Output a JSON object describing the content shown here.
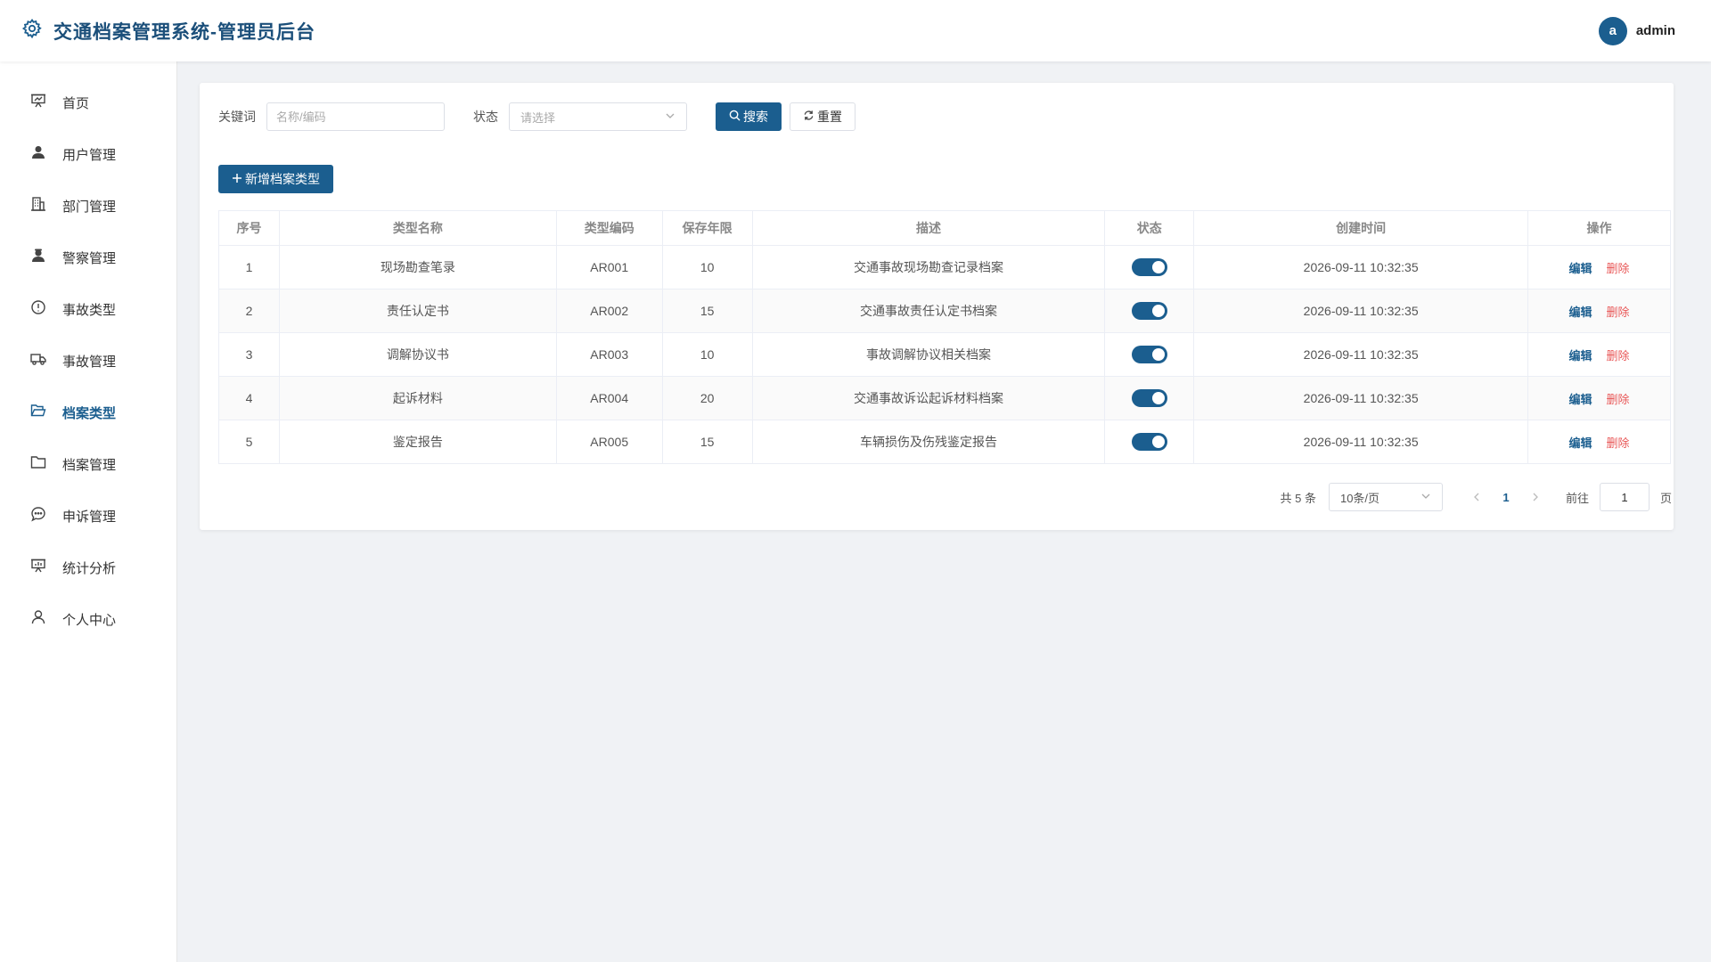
{
  "app": {
    "title": "交通档案管理系统-管理员后台"
  },
  "user": {
    "avatar_letter": "a",
    "name": "admin"
  },
  "sidebar": {
    "items": [
      {
        "label": "首页",
        "icon": "presentation-icon",
        "active": false
      },
      {
        "label": "用户管理",
        "icon": "user-icon",
        "active": false
      },
      {
        "label": "部门管理",
        "icon": "building-icon",
        "active": false
      },
      {
        "label": "警察管理",
        "icon": "police-icon",
        "active": false
      },
      {
        "label": "事故类型",
        "icon": "warning-circle-icon",
        "active": false
      },
      {
        "label": "事故管理",
        "icon": "truck-icon",
        "active": false
      },
      {
        "label": "档案类型",
        "icon": "folder-open-icon",
        "active": true
      },
      {
        "label": "档案管理",
        "icon": "folder-icon",
        "active": false
      },
      {
        "label": "申诉管理",
        "icon": "chat-icon",
        "active": false
      },
      {
        "label": "统计分析",
        "icon": "chart-board-icon",
        "active": false
      },
      {
        "label": "个人中心",
        "icon": "person-outline-icon",
        "active": false
      }
    ]
  },
  "filter": {
    "keyword_label": "关键词",
    "keyword_placeholder": "名称/编码",
    "keyword_value": "",
    "status_label": "状态",
    "status_placeholder": "请选择",
    "search_label": "搜索",
    "reset_label": "重置"
  },
  "toolbar": {
    "add_label": "新增档案类型"
  },
  "table": {
    "columns": [
      "序号",
      "类型名称",
      "类型编码",
      "保存年限",
      "描述",
      "状态",
      "创建时间",
      "操作"
    ],
    "rows": [
      {
        "index": "1",
        "name": "现场勘查笔录",
        "code": "AR001",
        "years": "10",
        "desc": "交通事故现场勘查记录档案",
        "enabled": true,
        "created": "2026-09-11 10:32:35"
      },
      {
        "index": "2",
        "name": "责任认定书",
        "code": "AR002",
        "years": "15",
        "desc": "交通事故责任认定书档案",
        "enabled": true,
        "created": "2026-09-11 10:32:35"
      },
      {
        "index": "3",
        "name": "调解协议书",
        "code": "AR003",
        "years": "10",
        "desc": "事故调解协议相关档案",
        "enabled": true,
        "created": "2026-09-11 10:32:35"
      },
      {
        "index": "4",
        "name": "起诉材料",
        "code": "AR004",
        "years": "20",
        "desc": "交通事故诉讼起诉材料档案",
        "enabled": true,
        "created": "2026-09-11 10:32:35"
      },
      {
        "index": "5",
        "name": "鉴定报告",
        "code": "AR005",
        "years": "15",
        "desc": "车辆损伤及伤残鉴定报告",
        "enabled": true,
        "created": "2026-09-11 10:32:35"
      }
    ],
    "edit_label": "编辑",
    "delete_label": "删除"
  },
  "pagination": {
    "total_text": "共 5 条",
    "page_size": "10条/页",
    "current_page": "1",
    "goto_label": "前往",
    "goto_value": "1",
    "page_suffix": "页"
  },
  "colors": {
    "primary": "#1b5e8f",
    "danger": "#e85757",
    "background": "#f0f2f5"
  }
}
